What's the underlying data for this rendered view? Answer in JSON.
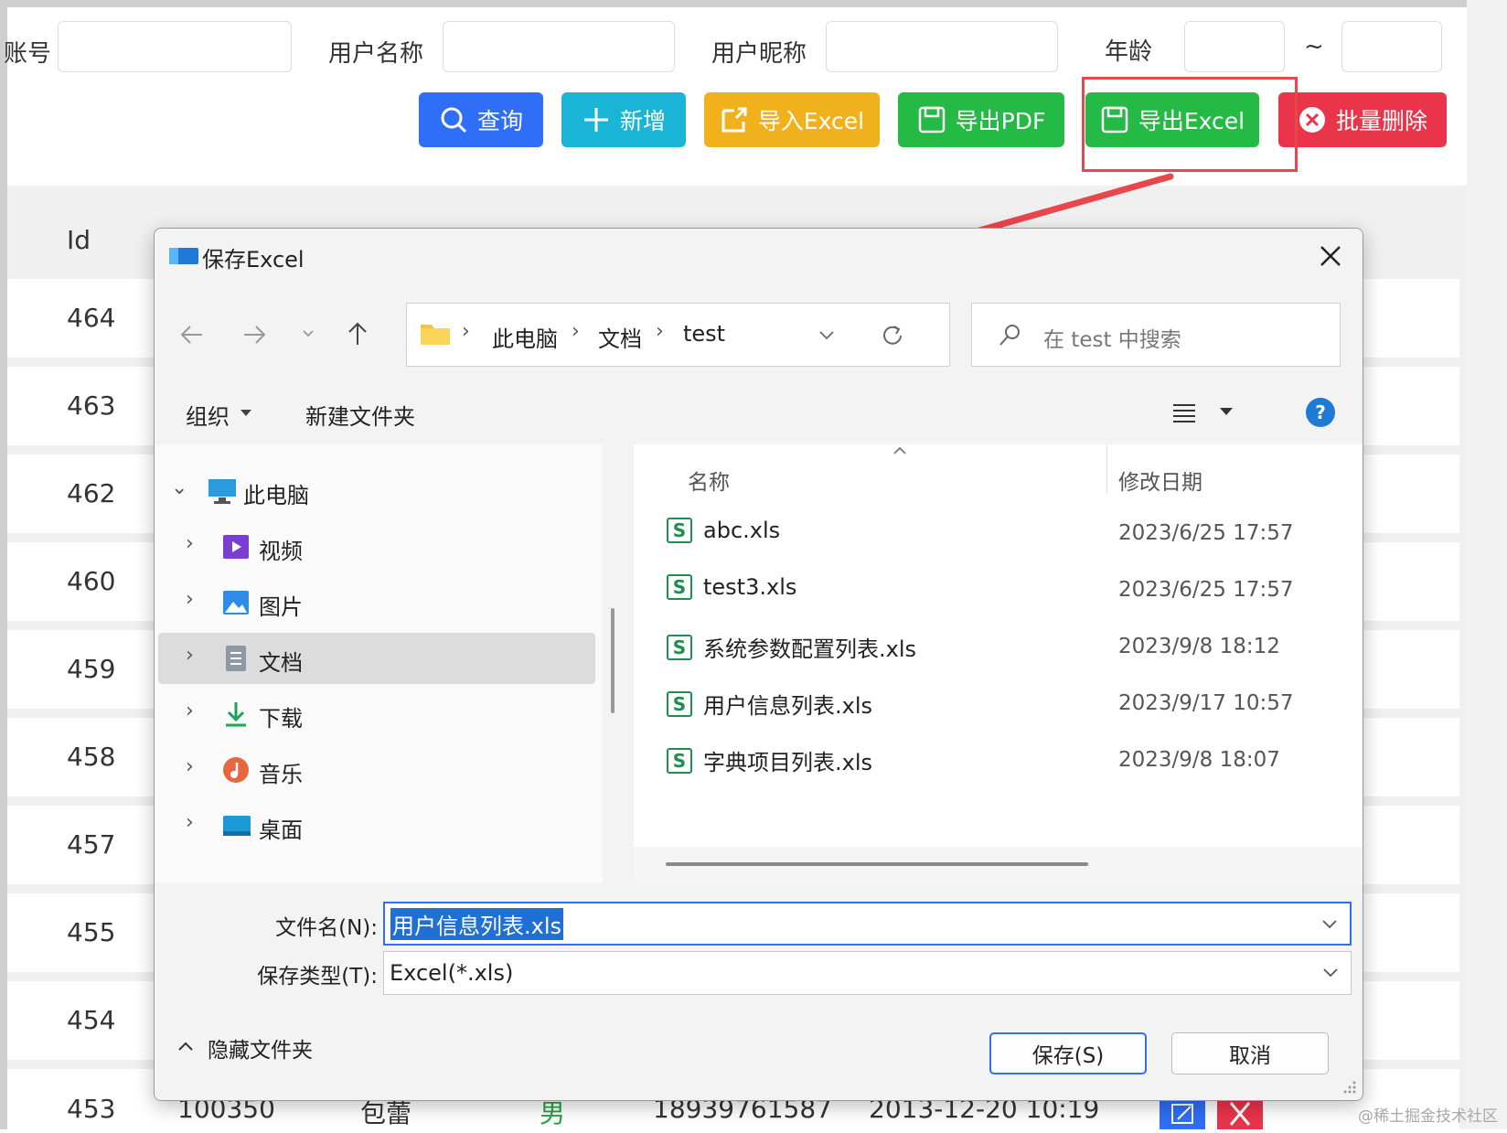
{
  "form": {
    "account_label": "账号",
    "username_label": "用户名称",
    "nickname_label": "用户昵称",
    "age_label": "年龄",
    "age_sep": "~"
  },
  "toolbar": {
    "query": "查询",
    "add": "新增",
    "import_excel": "导入Excel",
    "export_pdf": "导出PDF",
    "export_excel": "导出Excel",
    "batch_delete": "批量删除"
  },
  "table": {
    "id_header": "Id",
    "ids": [
      "464",
      "463",
      "462",
      "460",
      "459",
      "458",
      "457",
      "455",
      "454",
      "453"
    ],
    "last_row": {
      "account": "100350",
      "name": "包蕾",
      "gender": "男",
      "phone": "18939761587",
      "time": "2013-12-20 10:19"
    }
  },
  "dialog": {
    "title": "保存Excel",
    "crumbs": [
      "此电脑",
      "文档",
      "test"
    ],
    "search_placeholder": "在 test 中搜索",
    "organize": "组织",
    "new_folder": "新建文件夹",
    "nav": [
      {
        "label": "此电脑",
        "icon": "computer-icon"
      },
      {
        "label": "视频",
        "icon": "video-icon"
      },
      {
        "label": "图片",
        "icon": "picture-icon"
      },
      {
        "label": "文档",
        "icon": "document-icon"
      },
      {
        "label": "下载",
        "icon": "download-icon"
      },
      {
        "label": "音乐",
        "icon": "music-icon"
      },
      {
        "label": "桌面",
        "icon": "desktop-icon"
      }
    ],
    "col_name": "名称",
    "col_date": "修改日期",
    "files": [
      {
        "name": "abc.xls",
        "date": "2023/6/25 17:57"
      },
      {
        "name": "test3.xls",
        "date": "2023/6/25 17:57"
      },
      {
        "name": "系统参数配置列表.xls",
        "date": "2023/9/8 18:12"
      },
      {
        "name": "用户信息列表.xls",
        "date": "2023/9/17 10:57"
      },
      {
        "name": "字典项目列表.xls",
        "date": "2023/9/8 18:07"
      }
    ],
    "filename_label": "文件名(N):",
    "filename_value": "用户信息列表.xls",
    "filetype_label": "保存类型(T):",
    "filetype_value": "Excel(*.xls)",
    "hide_folders": "隐藏文件夹",
    "save_btn": "保存(S)",
    "cancel_btn": "取消"
  },
  "watermark": "@稀土掘金技术社区",
  "colors": {
    "accent": "#2f6ef6",
    "highlight": "#e8474c"
  }
}
